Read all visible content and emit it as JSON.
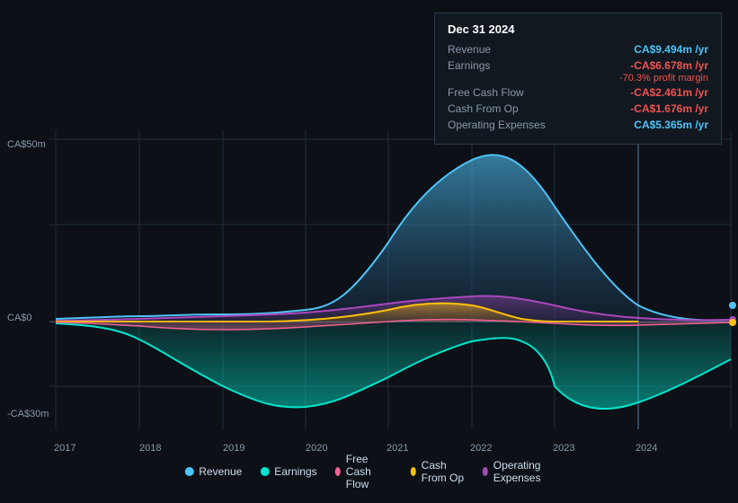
{
  "tooltip": {
    "date": "Dec 31 2024",
    "rows": [
      {
        "label": "Revenue",
        "value": "CA$9.494m /yr",
        "color": "blue"
      },
      {
        "label": "Earnings",
        "value": "-CA$6.678m /yr",
        "color": "red",
        "sub": "-70.3% profit margin"
      },
      {
        "label": "Free Cash Flow",
        "value": "-CA$2.461m /yr",
        "color": "red"
      },
      {
        "label": "Cash From Op",
        "value": "-CA$1.676m /yr",
        "color": "red"
      },
      {
        "label": "Operating Expenses",
        "value": "CA$5.365m /yr",
        "color": "blue"
      }
    ]
  },
  "chart": {
    "y_labels": [
      "CA$50m",
      "CA$0",
      "-CA$30m"
    ],
    "x_labels": [
      "2017",
      "2018",
      "2019",
      "2020",
      "2021",
      "2022",
      "2023",
      "2024"
    ]
  },
  "legend": [
    {
      "label": "Revenue",
      "color": "#4fc3f7",
      "id": "revenue"
    },
    {
      "label": "Earnings",
      "color": "#00e5cc",
      "id": "earnings"
    },
    {
      "label": "Free Cash Flow",
      "color": "#f06292",
      "id": "free-cash-flow"
    },
    {
      "label": "Cash From Op",
      "color": "#ffc107",
      "id": "cash-from-op"
    },
    {
      "label": "Operating Expenses",
      "color": "#ab47bc",
      "id": "operating-expenses"
    }
  ]
}
